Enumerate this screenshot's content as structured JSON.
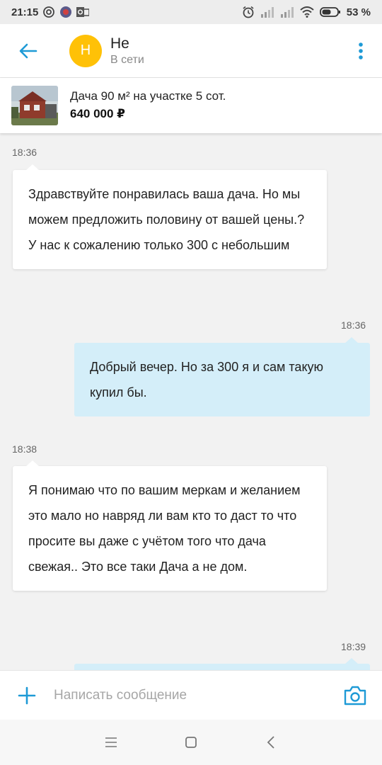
{
  "status_bar": {
    "time": "21:15",
    "battery": "53 %",
    "icons": [
      "at-icon",
      "notification-icon",
      "outlook-icon",
      "alarm-icon",
      "signal-icon",
      "signal-icon",
      "wifi-icon",
      "battery-icon"
    ]
  },
  "header": {
    "avatar_letter": "Н",
    "name": "Не",
    "status": "В сети"
  },
  "listing": {
    "title": "Дача 90 м² на участке 5 сот.",
    "price": "640 000 ₽"
  },
  "messages": [
    {
      "direction": "in",
      "time": "18:36",
      "text": "Здравствуйте понравилась ваша дача. Но мы можем предложить половину от вашей цены.? У нас к сожалению только 300 с небольшим"
    },
    {
      "direction": "out",
      "time": "18:36",
      "text": "Добрый вечер. Но за 300 я и сам такую купил бы."
    },
    {
      "direction": "in",
      "time": "18:38",
      "text": "Я понимаю что по вашим меркам и желанием это мало но навряд ли вам кто то даст то что просите вы даже с учётом того что дача свежая.. Это все таки Дача а не дом."
    },
    {
      "direction": "out",
      "time": "18:39",
      "text": ""
    }
  ],
  "composer": {
    "placeholder": "Написать сообщение"
  },
  "colors": {
    "accent": "#1e9ad6",
    "avatar": "#ffc107",
    "outgoing_bubble": "#d4eef9",
    "incoming_bubble": "#ffffff",
    "background": "#f2f2f2"
  }
}
